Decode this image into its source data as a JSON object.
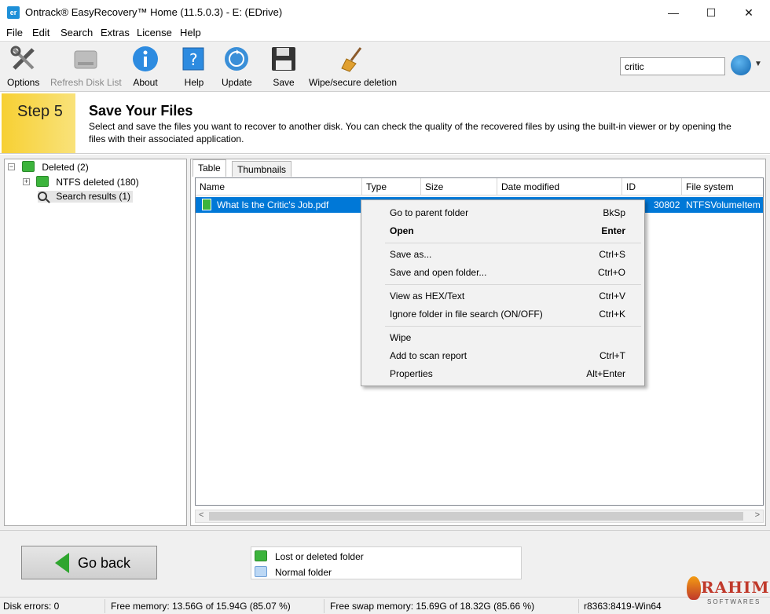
{
  "window": {
    "title": "Ontrack® EasyRecovery™ Home (11.5.0.3) - E: (EDrive)",
    "icon_text": "er",
    "controls": {
      "minimize": "—",
      "maximize": "☐",
      "close": "✕"
    }
  },
  "menu": [
    "File",
    "Edit",
    "Search",
    "Extras",
    "License",
    "Help"
  ],
  "toolbar": {
    "options": "Options",
    "refresh": "Refresh Disk List",
    "about": "About",
    "help": "Help",
    "update": "Update",
    "save": "Save",
    "wipe": "Wipe/secure deletion",
    "search_value": "critic",
    "dropdown_glyph": "▼"
  },
  "step": {
    "label": "Step 5",
    "title": "Save Your Files",
    "description": "Select and save the files you want to recover to another disk. You can check the quality of the recovered files by using the built-in viewer or by opening the files with their associated application."
  },
  "tree": {
    "root": "Deleted (2)",
    "ntfs": "NTFS deleted (180)",
    "search": "Search results (1)",
    "collapse_glyph": "−",
    "expand_glyph": "+"
  },
  "tabs": [
    "Table",
    "Thumbnails"
  ],
  "table": {
    "columns": [
      "Name",
      "Type",
      "Size",
      "Date modified",
      "ID",
      "File system"
    ],
    "rows": [
      {
        "name": "What Is the Critic's Job.pdf",
        "id": "30802",
        "fs": "NTFSVolumeItem"
      }
    ],
    "scroll_left": "<",
    "scroll_right": ">"
  },
  "context_menu": [
    {
      "label": "Go to parent folder",
      "shortcut": "BkSp"
    },
    {
      "label": "Open",
      "shortcut": "Enter"
    },
    {
      "label": "Save as...",
      "shortcut": "Ctrl+S"
    },
    {
      "label": "Save and open folder...",
      "shortcut": "Ctrl+O"
    },
    {
      "label": "View as HEX/Text",
      "shortcut": "Ctrl+V"
    },
    {
      "label": "Ignore folder in file search (ON/OFF)",
      "shortcut": "Ctrl+K"
    },
    {
      "label": "Wipe",
      "shortcut": ""
    },
    {
      "label": "Add to scan report",
      "shortcut": "Ctrl+T"
    },
    {
      "label": "Properties",
      "shortcut": "Alt+Enter"
    }
  ],
  "bottom": {
    "go_back": "Go back",
    "legend": [
      "Lost or deleted folder",
      "Normal folder"
    ]
  },
  "status": {
    "disk_errors": "Disk errors: 0",
    "free_memory": "Free memory: 13.56G of 15.94G (85.07 %)",
    "free_swap": "Free swap memory: 15.69G of 18.32G (85.66 %)",
    "build": "r8363:8419-Win64"
  },
  "watermark": {
    "big": "RAHIM",
    "small": "SOFTWARES"
  },
  "colors": {
    "selection": "#0078d7",
    "step_accent": "#f7d033",
    "folder_green": "#3cb43c"
  }
}
